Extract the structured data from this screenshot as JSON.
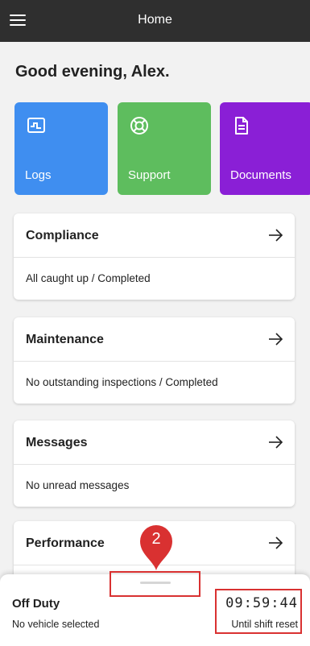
{
  "header": {
    "title": "Home",
    "menu_icon": "hamburger-menu-icon"
  },
  "greeting": "Good evening, Alex.",
  "tiles": [
    {
      "label": "Logs",
      "icon": "logs-chart-icon",
      "color": "#3f8ef0"
    },
    {
      "label": "Support",
      "icon": "lifebuoy-icon",
      "color": "#5ebd5e"
    },
    {
      "label": "Documents",
      "icon": "document-icon",
      "color": "#8a1fd6"
    }
  ],
  "cards": [
    {
      "title": "Compliance",
      "text": "All caught up / Completed"
    },
    {
      "title": "Maintenance",
      "text": "No outstanding inspections / Completed"
    },
    {
      "title": "Messages",
      "text": "No unread messages"
    },
    {
      "title": "Performance",
      "text": ""
    }
  ],
  "bottom_sheet": {
    "status": "Off Duty",
    "vehicle": "No vehicle selected",
    "timer": "09:59:44",
    "timer_label": "Until shift reset"
  },
  "marker": {
    "label": "2",
    "color": "#d93131"
  }
}
